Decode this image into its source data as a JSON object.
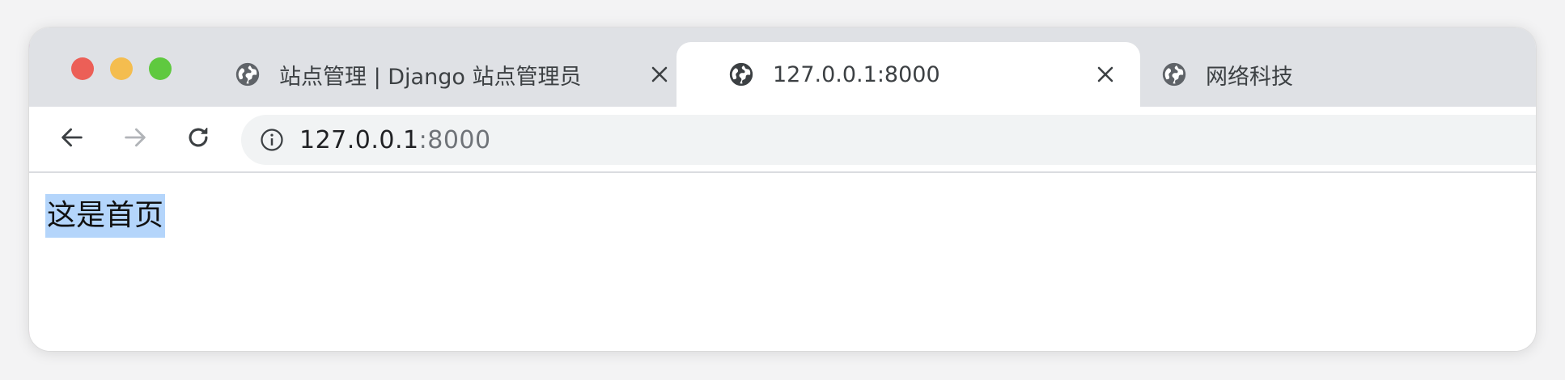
{
  "browser": {
    "tabs": [
      {
        "title": "站点管理 | Django 站点管理员",
        "active": false,
        "icon": "globe-icon"
      },
      {
        "title": "127.0.0.1:8000",
        "active": true,
        "icon": "globe-icon"
      },
      {
        "title": "网络科技",
        "active": false,
        "icon": "globe-icon"
      }
    ],
    "address_bar": {
      "host": "127.0.0.1",
      "port": ":8000",
      "icon": "info-icon"
    },
    "nav": {
      "back_icon": "arrow-left-icon",
      "forward_icon": "arrow-right-icon",
      "reload_icon": "reload-icon"
    }
  },
  "page": {
    "heading": "这是首页",
    "selection_color": "#b4d5fb"
  },
  "colors": {
    "tabstrip": "#dfe1e5",
    "close_red": "#ec5f57",
    "minimize_yellow": "#f4bd4f",
    "maximize_green": "#5fc93f"
  }
}
